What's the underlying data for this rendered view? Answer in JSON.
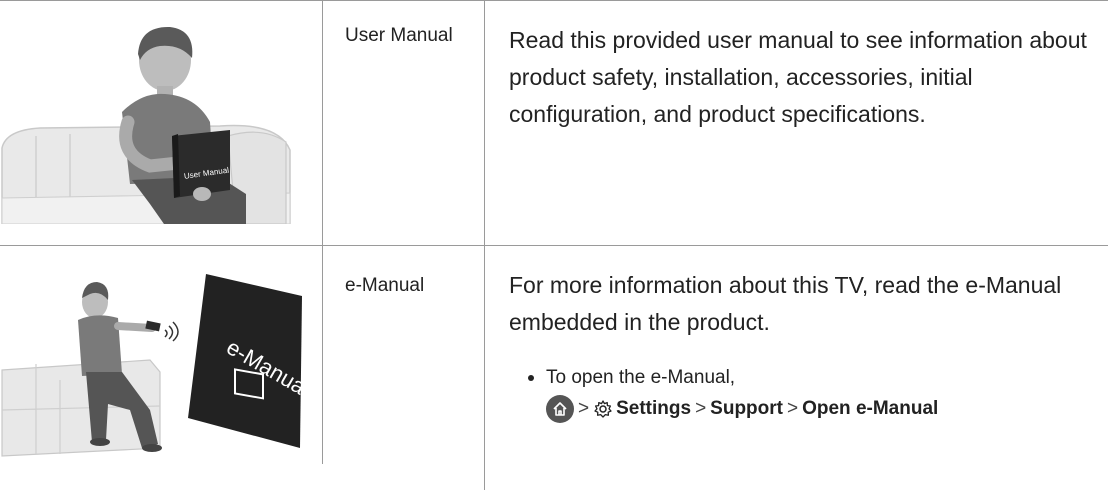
{
  "rows": [
    {
      "label": "User Manual",
      "description": "Read this provided user manual to see information about product safety, installation, accessories, initial configuration, and product specifications.",
      "illustration": {
        "book_text": "User Manual"
      }
    },
    {
      "label": "e-Manual",
      "description": "For more information about this TV, read the e-Manual embedded in the product.",
      "illustration": {
        "screen_text": "e-Manual"
      },
      "bullet": "To open the e-Manual,",
      "nav": {
        "home_icon": "home-icon",
        "separator": ">",
        "settings_icon": "gear-icon",
        "settings": "Settings",
        "support": "Support",
        "open": "Open e-Manual"
      }
    }
  ],
  "colors": {
    "rule": "#9a9a9a",
    "text": "#222222",
    "home_button": "#555555"
  }
}
